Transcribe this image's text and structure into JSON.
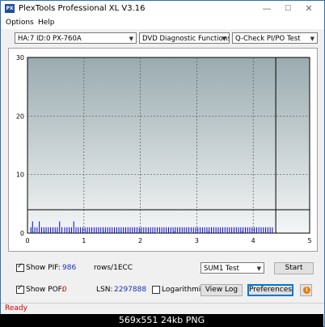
{
  "window": {
    "title": "PlexTools Professional XL V3.16",
    "controls": {
      "minimize": "—",
      "maximize": "☐",
      "close": "✕"
    }
  },
  "menu": {
    "options": "Options",
    "help": "Help"
  },
  "toolbar": {
    "drive": "HA:7 ID:0  PX-760A",
    "function": "DVD Diagnostic Functions",
    "test": "Q-Check PI/PO Test"
  },
  "chart_data": {
    "type": "bar",
    "x_ticks": [
      "0",
      "1",
      "2",
      "3",
      "4",
      "5"
    ],
    "y_ticks": [
      "30",
      "20",
      "10",
      "0"
    ],
    "xlim": [
      0,
      5
    ],
    "ylim": [
      0,
      30
    ],
    "threshold": 4,
    "marker_x": 4.4,
    "grid": true,
    "series": [
      {
        "color": "#0000d0",
        "points": [
          [
            0.06,
            1
          ],
          [
            0.09,
            2
          ],
          [
            0.13,
            1
          ],
          [
            0.17,
            1
          ],
          [
            0.21,
            2
          ],
          [
            0.25,
            1
          ],
          [
            0.29,
            1
          ],
          [
            0.33,
            1
          ],
          [
            0.37,
            1
          ],
          [
            0.41,
            1
          ],
          [
            0.45,
            1
          ],
          [
            0.49,
            1
          ],
          [
            0.53,
            1
          ],
          [
            0.57,
            2
          ],
          [
            0.61,
            1
          ],
          [
            0.66,
            1
          ],
          [
            0.7,
            1
          ],
          [
            0.74,
            1
          ],
          [
            0.78,
            1
          ],
          [
            0.82,
            2
          ],
          [
            0.86,
            1
          ],
          [
            0.9,
            1
          ],
          [
            0.94,
            1
          ],
          [
            0.98,
            1
          ],
          [
            1.02,
            1
          ],
          [
            1.06,
            1
          ],
          [
            1.1,
            1
          ],
          [
            1.14,
            1
          ],
          [
            1.18,
            1
          ],
          [
            1.22,
            1
          ],
          [
            1.26,
            1
          ],
          [
            1.3,
            1
          ],
          [
            1.34,
            1
          ],
          [
            1.38,
            1
          ],
          [
            1.42,
            1
          ],
          [
            1.46,
            1
          ],
          [
            1.5,
            1
          ],
          [
            1.54,
            1
          ],
          [
            1.58,
            1
          ],
          [
            1.62,
            1
          ],
          [
            1.66,
            1
          ],
          [
            1.7,
            1
          ],
          [
            1.74,
            1
          ],
          [
            1.78,
            1
          ],
          [
            1.82,
            1
          ],
          [
            1.86,
            1
          ],
          [
            1.9,
            1
          ],
          [
            1.94,
            1
          ],
          [
            1.98,
            1
          ],
          [
            2.02,
            1
          ],
          [
            2.06,
            1
          ],
          [
            2.1,
            1
          ],
          [
            2.14,
            1
          ],
          [
            2.18,
            1
          ],
          [
            2.22,
            1
          ],
          [
            2.26,
            1
          ],
          [
            2.3,
            1
          ],
          [
            2.34,
            1
          ],
          [
            2.38,
            1
          ],
          [
            2.42,
            1
          ],
          [
            2.46,
            1
          ],
          [
            2.5,
            1
          ],
          [
            2.54,
            1
          ],
          [
            2.58,
            1
          ],
          [
            2.62,
            1
          ],
          [
            2.66,
            1
          ],
          [
            2.7,
            1
          ],
          [
            2.74,
            1
          ],
          [
            2.78,
            1
          ],
          [
            2.82,
            1
          ],
          [
            2.86,
            1
          ],
          [
            2.9,
            1
          ],
          [
            2.94,
            1
          ],
          [
            2.98,
            1
          ],
          [
            3.02,
            1
          ],
          [
            3.06,
            1
          ],
          [
            3.1,
            1
          ],
          [
            3.14,
            1
          ],
          [
            3.18,
            1
          ],
          [
            3.22,
            1
          ],
          [
            3.26,
            1
          ],
          [
            3.3,
            1
          ],
          [
            3.34,
            1
          ],
          [
            3.38,
            1
          ],
          [
            3.42,
            1
          ],
          [
            3.46,
            1
          ],
          [
            3.5,
            1
          ],
          [
            3.54,
            1
          ],
          [
            3.58,
            1
          ],
          [
            3.62,
            1
          ],
          [
            3.66,
            1
          ],
          [
            3.7,
            1
          ],
          [
            3.74,
            1
          ],
          [
            3.78,
            1
          ],
          [
            3.82,
            1
          ],
          [
            3.86,
            1
          ],
          [
            3.9,
            1
          ],
          [
            3.94,
            1
          ],
          [
            3.98,
            1
          ],
          [
            4.02,
            1
          ],
          [
            4.06,
            1
          ],
          [
            4.1,
            1
          ],
          [
            4.14,
            1
          ],
          [
            4.18,
            1
          ],
          [
            4.22,
            1
          ],
          [
            4.26,
            1
          ],
          [
            4.3,
            1
          ],
          [
            4.34,
            1
          ]
        ]
      },
      {
        "color": "#00a000",
        "points": [
          [
            0.1,
            0.3
          ],
          [
            0.3,
            0.3
          ],
          [
            0.5,
            0.3
          ],
          [
            0.75,
            0.3
          ],
          [
            1.05,
            0.3
          ],
          [
            1.35,
            0.3
          ],
          [
            1.65,
            0.3
          ],
          [
            2.0,
            0.3
          ],
          [
            2.3,
            0.3
          ],
          [
            2.6,
            0.3
          ],
          [
            2.9,
            0.3
          ],
          [
            3.2,
            0.3
          ],
          [
            3.5,
            0.3
          ],
          [
            3.8,
            0.3
          ],
          [
            4.1,
            0.3
          ]
        ]
      }
    ]
  },
  "stats": {
    "show_pif_label": "Show PIF:",
    "pif_value": "986",
    "unit": "rows/1ECC",
    "show_pof_label": "Show POF:",
    "pof_value": "0",
    "lsn_label": "LSN:",
    "lsn_value": "2297888",
    "log_label": "Logarithmic",
    "show_pif_checked": true,
    "show_pof_checked": true,
    "log_checked": false
  },
  "controls": {
    "sum_select": "SUM1 Test",
    "start": "Start",
    "view_log": "View Log",
    "preferences": "Preferences",
    "info": "i"
  },
  "status": {
    "text": "Ready"
  },
  "overlay": {
    "text": "569x551  24kb  PNG"
  }
}
